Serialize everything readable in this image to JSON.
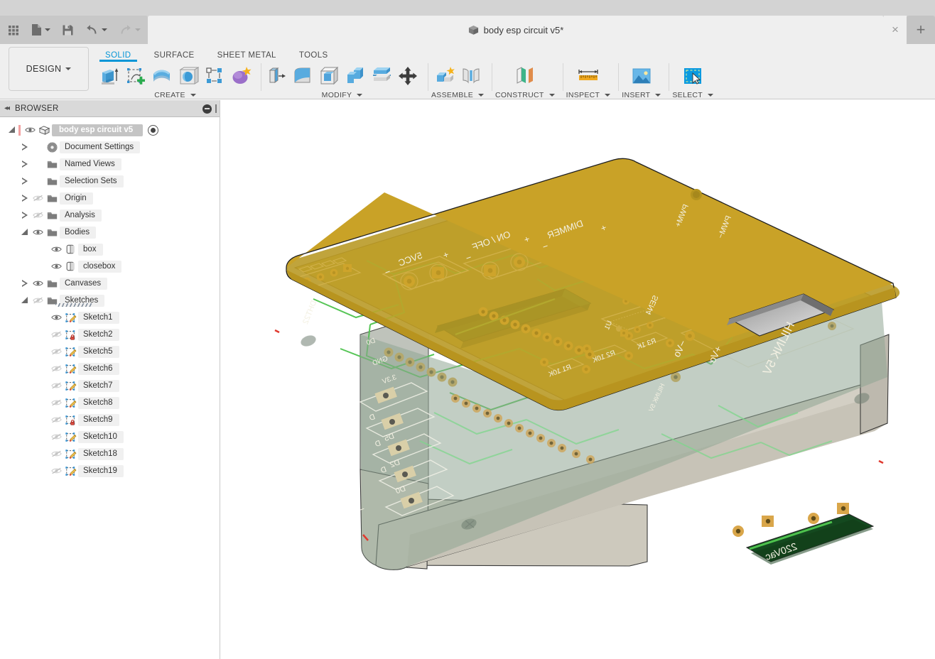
{
  "app": {
    "document_title": "body esp circuit v5*",
    "workspace": "DESIGN",
    "close_label": "×",
    "new_tab_label": "+"
  },
  "quick_access": [
    {
      "name": "show-all-apps",
      "icon": "grid-icon"
    },
    {
      "name": "new-file",
      "icon": "file-icon",
      "has_dropdown": true
    },
    {
      "name": "save",
      "icon": "save-icon"
    },
    {
      "name": "undo",
      "icon": "undo-arrow-icon",
      "has_dropdown": true
    },
    {
      "name": "redo",
      "icon": "redo-arrow-icon",
      "has_dropdown": true,
      "disabled": true
    }
  ],
  "ribbon": {
    "tabs": [
      {
        "label": "SOLID",
        "active": true
      },
      {
        "label": "SURFACE",
        "active": false
      },
      {
        "label": "SHEET METAL",
        "active": false
      },
      {
        "label": "TOOLS",
        "active": false
      }
    ],
    "panels": [
      {
        "label": "CREATE",
        "has_dropdown": true,
        "tools": [
          "extrude-icon",
          "create-sketch-icon",
          "revolve-icon",
          "sphere-icon",
          "pattern-icon",
          "form-icon"
        ]
      },
      {
        "label": "MODIFY",
        "has_dropdown": true,
        "tools": [
          "press-pull-icon",
          "fillet-icon",
          "shell-icon",
          "combine-icon",
          "split-face-icon",
          "move-copy-icon"
        ]
      },
      {
        "label": "ASSEMBLE",
        "has_dropdown": true,
        "tools": [
          "new-component-icon",
          "joint-icon"
        ]
      },
      {
        "label": "CONSTRUCT",
        "has_dropdown": true,
        "tools": [
          "offset-plane-icon"
        ]
      },
      {
        "label": "INSPECT",
        "has_dropdown": true,
        "tools": [
          "measure-icon"
        ]
      },
      {
        "label": "INSERT",
        "has_dropdown": true,
        "tools": [
          "insert-image-icon"
        ]
      },
      {
        "label": "SELECT",
        "has_dropdown": true,
        "tools": [
          "select-cursor-icon"
        ]
      }
    ]
  },
  "browser": {
    "title": "BROWSER",
    "collapse_icon": "double-left-arrow-icon",
    "minimize_icon": "minus-circle-icon",
    "resize_handle": "panel-grip",
    "root": {
      "label": "body esp circuit v5",
      "expanded": true,
      "visible": true,
      "icon": "component-icon",
      "activate_icon": "radio-dot-icon"
    },
    "items": [
      {
        "label": "Document Settings",
        "icon": "gear-icon",
        "indent": 1,
        "expanded": false,
        "eye": "none"
      },
      {
        "label": "Named Views",
        "icon": "folder-icon",
        "indent": 1,
        "expanded": false,
        "eye": "none"
      },
      {
        "label": "Selection Sets",
        "icon": "folder-icon",
        "indent": 1,
        "expanded": false,
        "eye": "none"
      },
      {
        "label": "Origin",
        "icon": "folder-icon",
        "indent": 1,
        "expanded": false,
        "eye": "hidden"
      },
      {
        "label": "Analysis",
        "icon": "folder-icon",
        "indent": 1,
        "expanded": false,
        "eye": "hidden"
      },
      {
        "label": "Bodies",
        "icon": "folder-icon",
        "indent": 1,
        "expanded": true,
        "eye": "visible"
      },
      {
        "label": "box",
        "icon": "body-icon",
        "indent": 2,
        "expanded": null,
        "eye": "visible"
      },
      {
        "label": "closebox",
        "icon": "body-icon",
        "indent": 2,
        "expanded": null,
        "eye": "visible"
      },
      {
        "label": "Canvases",
        "icon": "folder-icon",
        "indent": 1,
        "expanded": false,
        "eye": "visible"
      },
      {
        "label": "Sketches",
        "icon": "folder-icon",
        "indent": 1,
        "expanded": true,
        "eye": "hidden",
        "underlined": true
      },
      {
        "label": "Sketch1",
        "icon": "sketch-icon",
        "indent": 2,
        "expanded": null,
        "eye": "visible"
      },
      {
        "label": "Sketch2",
        "icon": "sketch-lock-icon",
        "indent": 2,
        "expanded": null,
        "eye": "hidden"
      },
      {
        "label": "Sketch5",
        "icon": "sketch-icon",
        "indent": 2,
        "expanded": null,
        "eye": "hidden"
      },
      {
        "label": "Sketch6",
        "icon": "sketch-icon",
        "indent": 2,
        "expanded": null,
        "eye": "hidden"
      },
      {
        "label": "Sketch7",
        "icon": "sketch-icon",
        "indent": 2,
        "expanded": null,
        "eye": "hidden"
      },
      {
        "label": "Sketch8",
        "icon": "sketch-icon",
        "indent": 2,
        "expanded": null,
        "eye": "hidden"
      },
      {
        "label": "Sketch9",
        "icon": "sketch-lock-icon",
        "indent": 2,
        "expanded": null,
        "eye": "hidden"
      },
      {
        "label": "Sketch10",
        "icon": "sketch-icon",
        "indent": 2,
        "expanded": null,
        "eye": "hidden"
      },
      {
        "label": "Sketch18",
        "icon": "sketch-icon",
        "indent": 2,
        "expanded": null,
        "eye": "hidden"
      },
      {
        "label": "Sketch19",
        "icon": "sketch-icon",
        "indent": 2,
        "expanded": null,
        "eye": "hidden"
      }
    ]
  },
  "model": {
    "description": "3D isometric view of a translucent enclosure with a gold lid over a green PCB",
    "colors": {
      "lid_gold": "#c9a227",
      "lid_gold_dark": "#b8941f",
      "pcb_green": "#8a8f3a",
      "pcb_green_dark": "#6f7430",
      "enclosure_body": "#cdc9bd",
      "enclosure_body_dark": "#b9b5a8",
      "enclosure_translucent": "#8fa593",
      "cutout_dark_green": "#14491f",
      "trace_green": "#4ec24e",
      "pad_gold": "#e0aa3c",
      "silkscreen": "#f3f0e2",
      "background": "#ffffff"
    },
    "silkscreen_labels": [
      "5VCC",
      "ON / OFF",
      "DIMMER",
      "SEN4",
      "U1",
      "R1 10K",
      "R2 10K",
      "R3 1K",
      "HILINK 5V",
      "+Vo",
      "−Vo",
      "220Vac",
      "DHT22",
      "D0",
      "GND",
      "3.3V",
      "D5",
      "D2",
      "+",
      "−"
    ]
  }
}
